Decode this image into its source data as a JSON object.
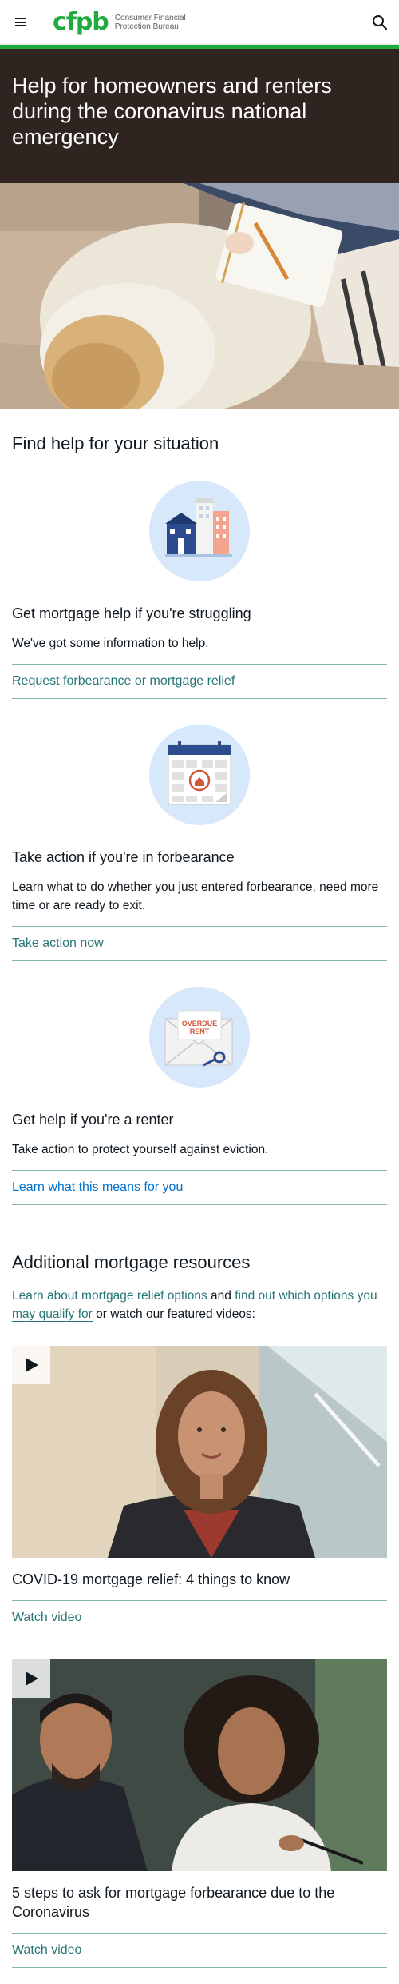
{
  "header": {
    "menu_icon": "hamburger-menu-icon",
    "logo_mark": "cfpb",
    "logo_line1": "Consumer Financial",
    "logo_line2": "Protection Bureau",
    "search_icon": "search-icon",
    "brand_green": "#20aa3f"
  },
  "hero": {
    "title": "Help for homeowners and renters during the coronavirus national emergency",
    "background": "#2f241f"
  },
  "situation": {
    "heading": "Find help for your situation",
    "cards": [
      {
        "icon": "buildings-icon",
        "title": "Get mortgage help if you're struggling",
        "body": "We've got some information to help.",
        "link": "Request forbearance or mortgage relief"
      },
      {
        "icon": "calendar-icon",
        "title": "Take action if you're in forbearance",
        "body": "Learn what to do whether you just entered forbearance, need more time or are ready to exit.",
        "link": "Take action now"
      },
      {
        "icon": "overdue-rent-envelope-icon",
        "icon_text_1": "OVERDUE",
        "icon_text_2": "RENT",
        "title": "Get help if you're a renter",
        "body": "Take action to protect yourself against eviction.",
        "link": "Learn what this means for you"
      }
    ]
  },
  "resources": {
    "heading": "Additional mortgage resources",
    "intro_link1": "Learn about mortgage relief options",
    "intro_and": " and ",
    "intro_link2": "find out which options you may qualify for",
    "intro_rest": " or watch our featured videos:",
    "videos": [
      {
        "play_icon": "play-icon",
        "title": "COVID-19 mortgage relief: 4 things to know",
        "link": "Watch video"
      },
      {
        "play_icon": "play-icon",
        "title": "5 steps to ask for mortgage forbearance due to the Coronavirus",
        "link": "Watch video"
      }
    ]
  },
  "colors": {
    "link_blue": "#0072ce",
    "link_teal": "#257675",
    "rule_teal": "#7eb7b0",
    "icon_circle": "#d6e8fa"
  }
}
